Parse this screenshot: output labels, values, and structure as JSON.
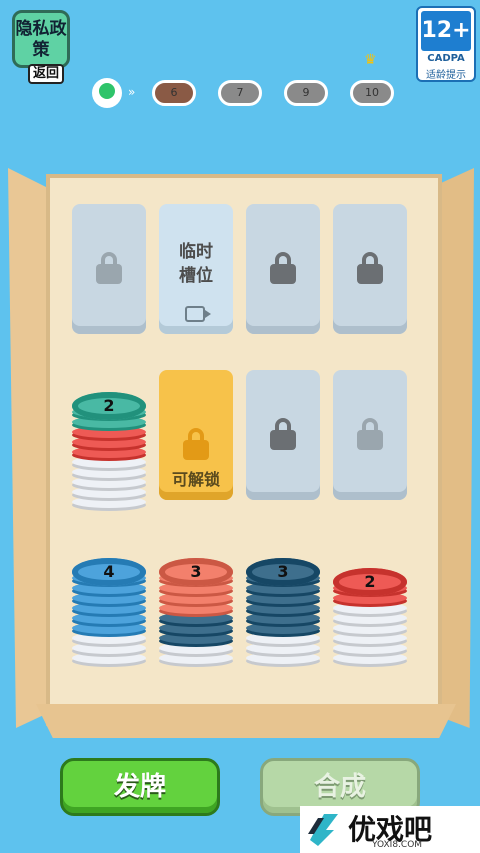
{
  "privacy": {
    "label": "隐私政策",
    "back_label": "返回"
  },
  "age_rating": {
    "rating": "12+",
    "org": "CADPA",
    "tip": "适龄提示"
  },
  "progress": {
    "completed": true,
    "levels": [
      {
        "label": "6",
        "current": true
      },
      {
        "label": "7"
      },
      {
        "label": "9"
      },
      {
        "label": "10",
        "crown": true
      }
    ]
  },
  "slots": [
    {
      "row": 0,
      "col": 0,
      "type": "locked-faint"
    },
    {
      "row": 0,
      "col": 1,
      "type": "temp",
      "label": "临时槽位",
      "icon": "video-icon"
    },
    {
      "row": 0,
      "col": 2,
      "type": "locked"
    },
    {
      "row": 0,
      "col": 3,
      "type": "locked"
    },
    {
      "row": 1,
      "col": 0,
      "type": "stack",
      "top_number": "2",
      "layers": [
        "white",
        "white",
        "white",
        "white",
        "white",
        "red",
        "red",
        "red",
        "teal",
        "teal"
      ]
    },
    {
      "row": 1,
      "col": 1,
      "type": "unlockable",
      "label": "可解锁"
    },
    {
      "row": 1,
      "col": 2,
      "type": "locked"
    },
    {
      "row": 1,
      "col": 3,
      "type": "locked-faint"
    },
    {
      "row": 2,
      "col": 0,
      "type": "stack",
      "top_number": "4",
      "layers": [
        "white",
        "white",
        "white",
        "blue",
        "blue",
        "blue",
        "blue",
        "blue",
        "blue"
      ]
    },
    {
      "row": 2,
      "col": 1,
      "type": "stack",
      "top_number": "3",
      "layers": [
        "white",
        "white",
        "navy",
        "navy",
        "navy",
        "salmon",
        "salmon",
        "salmon",
        "salmon"
      ]
    },
    {
      "row": 2,
      "col": 2,
      "type": "stack",
      "top_number": "3",
      "layers": [
        "white",
        "white",
        "white",
        "navy",
        "navy",
        "navy",
        "navy",
        "navy",
        "navy"
      ]
    },
    {
      "row": 2,
      "col": 3,
      "type": "stack",
      "top_number": "2",
      "layers": [
        "white",
        "white",
        "white",
        "white",
        "white",
        "white",
        "red",
        "red"
      ]
    }
  ],
  "colors": {
    "white": "#eef1f6",
    "red": "#ee5a55",
    "teal": "#49b9a4",
    "blue": "#4da3dc",
    "navy": "#3e6f8d",
    "salmon": "#f3806c"
  },
  "buttons": {
    "deal": "发牌",
    "merge": "合成"
  },
  "brand": {
    "name": "优戏吧",
    "url": "YOXI8.COM"
  }
}
